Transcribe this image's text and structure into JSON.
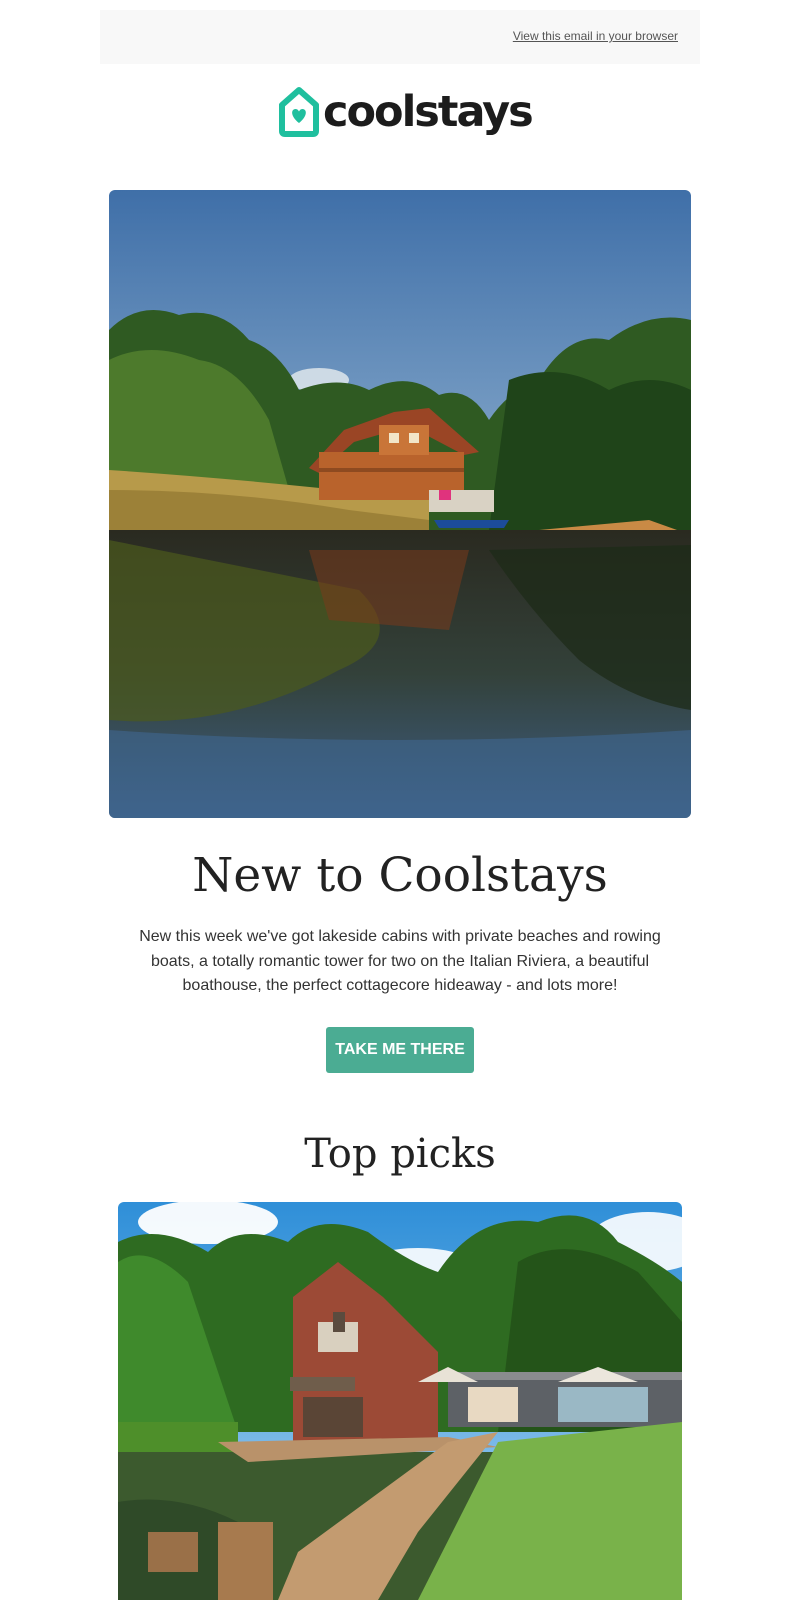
{
  "preheader": {
    "browser_link": "View this email in your browser"
  },
  "brand": {
    "name": "coolstays",
    "accent": "#1fbf9e"
  },
  "hero": {
    "image": "lakeside-log-cabin-photo",
    "title": "New to Coolstays",
    "body": "New this week we've got lakeside cabins with private beaches and rowing boats, a totally romantic tower for two on the Italian Riviera, a beautiful boathouse, the perfect cottagecore hideaway - and lots more!",
    "cta_label": "TAKE ME THERE",
    "cta_color": "#4bac93"
  },
  "top_picks": {
    "title": "Top picks",
    "items": [
      {
        "image": "brick-boathouse-jetty-photo"
      }
    ]
  }
}
